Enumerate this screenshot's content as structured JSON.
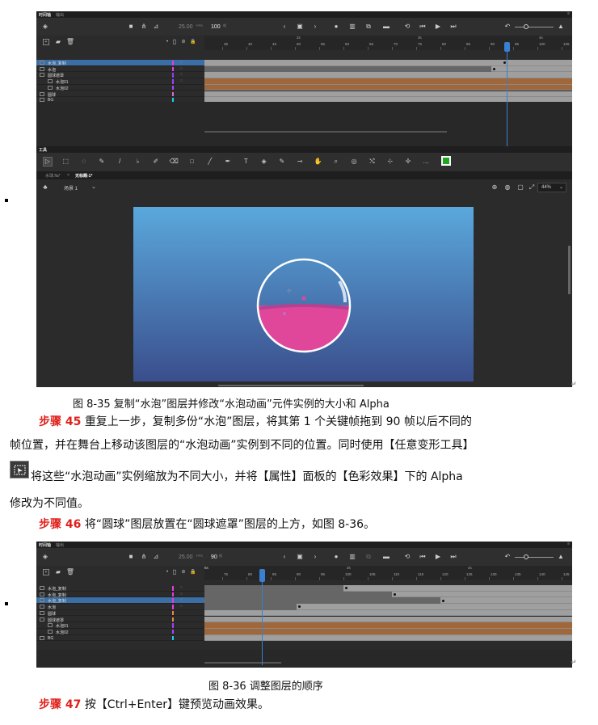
{
  "fig1": {
    "panel_title": "时间轴",
    "panel_tab2": "输出",
    "fps": "25.00",
    "fps_unit": "FPS",
    "frame": "100",
    "frame_unit": "帧",
    "ruler_marks": [
      "35",
      "40",
      "45",
      "50",
      "55",
      "60",
      "65",
      "70",
      "75",
      "80",
      "85",
      "90",
      "95",
      "100",
      "105",
      "110"
    ],
    "ruler_secs": [
      "2s",
      "3s",
      "4s"
    ],
    "layers": [
      {
        "name": "水泡_复制",
        "color": "#e040e0",
        "selected": true
      },
      {
        "name": "水泡",
        "color": "#e040e0"
      },
      {
        "name": "圆球遮罩",
        "color": "#8844ff"
      },
      {
        "name": "水泡01",
        "color": "#9944ff"
      },
      {
        "name": "水泡02",
        "color": "#aa44ff"
      },
      {
        "name": "圆球",
        "color": "#e06cc8"
      },
      {
        "name": "BG",
        "color": "#22ccee"
      }
    ],
    "tools_title": "工具",
    "doc_tab1": "水球.fla*",
    "doc_tab2": "无标题-1*",
    "scene": "场景 1",
    "zoom": "44%"
  },
  "caption1": "图 8-35  复制“水泡”图层并修改“水泡动画”元件实例的大小和 Alpha",
  "step45": {
    "label": "步骤 45",
    "line1": "重复上一步，复制多份“水泡”图层，将其第 1 个关键帧拖到 90 帧以后不同的",
    "line2": "帧位置，并在舞台上移动该图层的“水泡动画”实例到不同的位置。同时使用【任意变形工具】",
    "line3": "将这些“水泡动画”实例缩放为不同大小，并将【属性】面板的【色彩效果】下的 Alpha",
    "line4": "修改为不同值。"
  },
  "step46": {
    "label": "步骤 46",
    "text": "将“圆球”图层放置在“圆球遮罩”图层的上方，如图 8-36。"
  },
  "fig2": {
    "panel_title": "时间轴",
    "panel_tab2": "输出",
    "fps": "25.00",
    "fps_unit": "FPS",
    "frame": "90",
    "frame_unit": "帧",
    "ruler_marks": [
      "75",
      "80",
      "85",
      "90",
      "95",
      "100",
      "105",
      "110",
      "115",
      "120",
      "125",
      "130",
      "135",
      "140",
      "145",
      "150"
    ],
    "ruler_secs": [
      "3s",
      "4s",
      "5s",
      "6s"
    ],
    "layers": [
      {
        "name": "水泡_复制",
        "color": "#e040e0"
      },
      {
        "name": "水泡_复制",
        "color": "#e040e0"
      },
      {
        "name": "水泡_复制",
        "color": "#e040e0",
        "selected": true
      },
      {
        "name": "水泡",
        "color": "#e040e0"
      },
      {
        "name": "圆球",
        "color": "#ee8844"
      },
      {
        "name": "圆球遮罩",
        "color": "#ee8844"
      },
      {
        "name": "水泡01",
        "color": "#9944ff"
      },
      {
        "name": "水泡02",
        "color": "#aa44ff"
      },
      {
        "name": "BG",
        "color": "#22ccee"
      }
    ]
  },
  "caption2": "图 8-36  调整图层的顺序",
  "step47": {
    "label": "步骤 47",
    "text": "按【Ctrl+Enter】键预览动画效果。"
  }
}
